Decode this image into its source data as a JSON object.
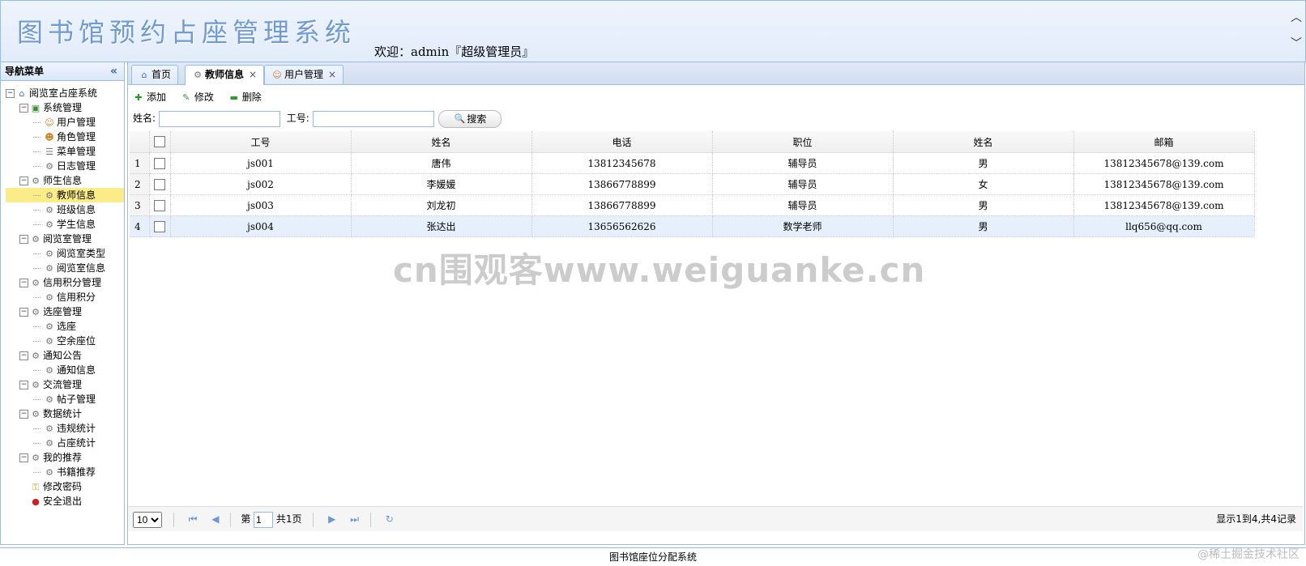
{
  "header": {
    "app_title": "图书馆预约占座管理系统",
    "welcome": "欢迎：admin『超级管理员』"
  },
  "west": {
    "title": "导航菜单",
    "tree": [
      {
        "label": "阅览室占座系统",
        "level": 0,
        "icon": "home-icon"
      },
      {
        "label": "系统管理",
        "level": 1,
        "icon": "folder-icon"
      },
      {
        "label": "用户管理",
        "level": 2,
        "icon": "user-icon"
      },
      {
        "label": "角色管理",
        "level": 2,
        "icon": "users-icon"
      },
      {
        "label": "菜单管理",
        "level": 2,
        "icon": "menu-icon"
      },
      {
        "label": "日志管理",
        "level": 2,
        "icon": "gear-icon"
      },
      {
        "label": "师生信息",
        "level": 1,
        "icon": "gear-icon"
      },
      {
        "label": "教师信息",
        "level": 2,
        "icon": "gear-icon",
        "selected": true
      },
      {
        "label": "班级信息",
        "level": 2,
        "icon": "gear-icon"
      },
      {
        "label": "学生信息",
        "level": 2,
        "icon": "gear-icon"
      },
      {
        "label": "阅览室管理",
        "level": 1,
        "icon": "gear-icon"
      },
      {
        "label": "阅览室类型",
        "level": 2,
        "icon": "gear-icon"
      },
      {
        "label": "阅览室信息",
        "level": 2,
        "icon": "gear-icon"
      },
      {
        "label": "信用积分管理",
        "level": 1,
        "icon": "gear-icon"
      },
      {
        "label": "信用积分",
        "level": 2,
        "icon": "gear-icon"
      },
      {
        "label": "选座管理",
        "level": 1,
        "icon": "gear-icon"
      },
      {
        "label": "选座",
        "level": 2,
        "icon": "gear-icon"
      },
      {
        "label": "空余座位",
        "level": 2,
        "icon": "gear-icon"
      },
      {
        "label": "通知公告",
        "level": 1,
        "icon": "gear-icon"
      },
      {
        "label": "通知信息",
        "level": 2,
        "icon": "gear-icon"
      },
      {
        "label": "交流管理",
        "level": 1,
        "icon": "gear-icon"
      },
      {
        "label": "帖子管理",
        "level": 2,
        "icon": "gear-icon"
      },
      {
        "label": "数据统计",
        "level": 1,
        "icon": "gear-icon"
      },
      {
        "label": "违规统计",
        "level": 2,
        "icon": "gear-icon"
      },
      {
        "label": "占座统计",
        "level": 2,
        "icon": "gear-icon"
      },
      {
        "label": "我的推荐",
        "level": 1,
        "icon": "gear-icon"
      },
      {
        "label": "书籍推荐",
        "level": 2,
        "icon": "gear-icon"
      },
      {
        "label": "修改密码",
        "level": 1,
        "icon": "key-icon"
      },
      {
        "label": "安全退出",
        "level": 1,
        "icon": "exit-icon"
      }
    ]
  },
  "tabs": [
    {
      "label": "首页",
      "icon": "home-icon",
      "closable": false
    },
    {
      "label": "教师信息",
      "icon": "gear-icon",
      "closable": true,
      "active": true
    },
    {
      "label": "用户管理",
      "icon": "user-icon",
      "closable": true
    }
  ],
  "toolbar": {
    "add": "添加",
    "edit": "修改",
    "delete": "删除"
  },
  "search": {
    "name_label": "姓名:",
    "id_label": "工号:",
    "button": "搜索"
  },
  "table": {
    "columns": [
      "工号",
      "姓名",
      "电话",
      "职位",
      "姓名",
      "邮箱"
    ],
    "rows": [
      [
        "js001",
        "唐伟",
        "13812345678",
        "辅导员",
        "男",
        "13812345678@139.com"
      ],
      [
        "js002",
        "李媛媛",
        "13866778899",
        "辅导员",
        "女",
        "13812345678@139.com"
      ],
      [
        "js003",
        "刘龙初",
        "13866778899",
        "辅导员",
        "男",
        "13812345678@139.com"
      ],
      [
        "js004",
        "张达出",
        "13656562626",
        "数学老师",
        "男",
        "llq656@qq.com"
      ]
    ]
  },
  "pager": {
    "page_size": "10",
    "page_prefix": "第",
    "page_number": "1",
    "page_total": "共1页",
    "info": "显示1到4,共4记录"
  },
  "footer": {
    "text": "图书馆座位分配系统"
  },
  "watermark": "cn围观客www.weiguanke.cn",
  "corner_mark": "@稀土掘金技术社区"
}
